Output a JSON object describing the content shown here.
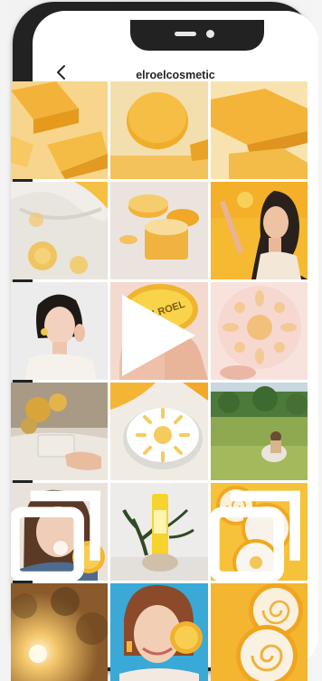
{
  "header": {
    "username": "elroelcosmetic",
    "back_icon": "chevron-left-icon"
  },
  "posts": [
    {
      "id": 1,
      "subject": "yellow product boxes"
    },
    {
      "id": 2,
      "subject": "yellow compact top view"
    },
    {
      "id": 3,
      "subject": "yellow product boxes close"
    },
    {
      "id": 4,
      "subject": "white fabric with sun pattern"
    },
    {
      "id": 5,
      "subject": "open cushion compacts"
    },
    {
      "id": 6,
      "subject": "woman holding compact"
    },
    {
      "id": 7,
      "subject": "woman applying cushion"
    },
    {
      "id": 8,
      "subject": "hand with puff",
      "puff_text": "ELROEL",
      "badge": "reel-icon"
    },
    {
      "id": 9,
      "subject": "sun pattern puff"
    },
    {
      "id": 10,
      "subject": "flowers and compact"
    },
    {
      "id": 11,
      "subject": "compact with sun print"
    },
    {
      "id": 12,
      "subject": "field with family"
    },
    {
      "id": 13,
      "subject": "child with compact",
      "badge": "album-icon"
    },
    {
      "id": 14,
      "subject": "yellow sunscreen tube"
    },
    {
      "id": 15,
      "subject": "stacked compacts",
      "badge": "album-icon"
    },
    {
      "id": 16,
      "subject": "sunlight through trees"
    },
    {
      "id": 17,
      "subject": "smiling woman with compact"
    },
    {
      "id": 18,
      "subject": "stacked spiral compacts"
    }
  ],
  "colors": {
    "brand_yellow": "#f5b936",
    "phone_frame": "#222222",
    "title_text": "#262626"
  }
}
